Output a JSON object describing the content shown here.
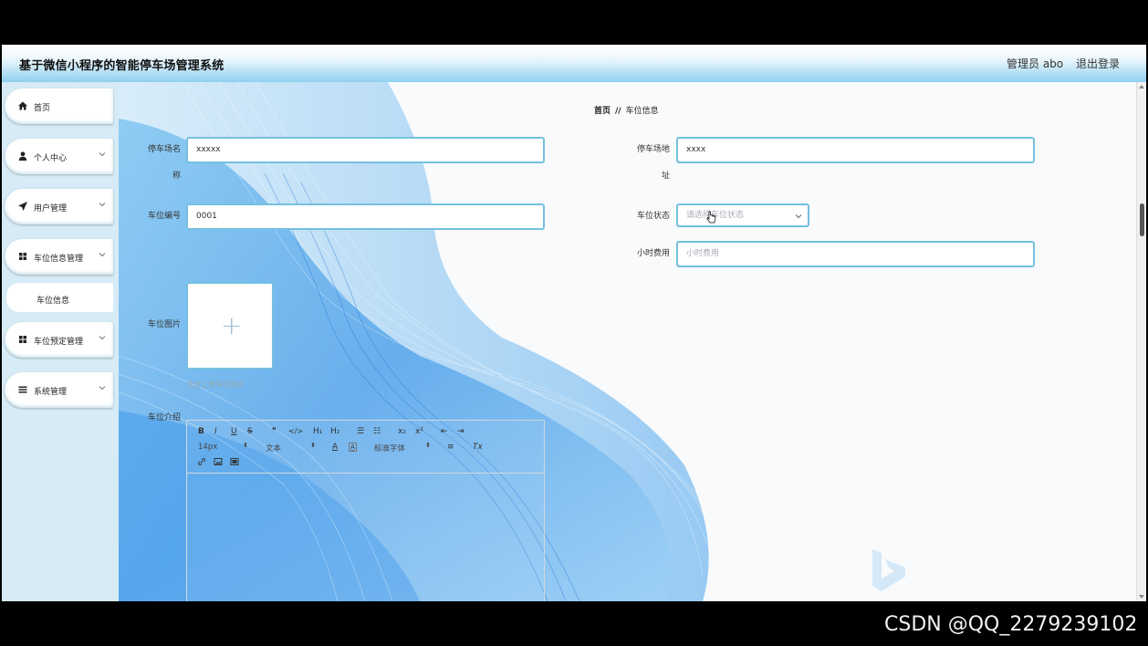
{
  "app": {
    "title": "基于微信小程序的智能停车场管理系统",
    "admin_label": "管理员 abo",
    "logout_label": "退出登录"
  },
  "sidebar": {
    "items": [
      {
        "label": "首页",
        "icon": "home-icon"
      },
      {
        "label": "个人中心",
        "icon": "user-icon"
      },
      {
        "label": "用户管理",
        "icon": "send-icon"
      },
      {
        "label": "车位信息管理",
        "icon": "grid-icon"
      },
      {
        "label": "车位信息",
        "icon": ""
      },
      {
        "label": "车位预定管理",
        "icon": "grid-icon"
      },
      {
        "label": "系统管理",
        "icon": "menu-icon"
      }
    ]
  },
  "breadcrumb": {
    "home": "首页",
    "separator": "//",
    "current": "车位信息"
  },
  "form": {
    "lot_name_label_line1": "停车场名",
    "lot_name_label_line2": "称",
    "lot_name_value": "xxxxx",
    "lot_address_label_line1": "停车场地",
    "lot_address_label_line2": "址",
    "lot_address_value": "xxxx",
    "space_no_label": "车位编号",
    "space_no_value": "0001",
    "status_label": "车位状态",
    "status_placeholder": "请选择车位状态",
    "hourly_fee_label": "小时费用",
    "hourly_fee_placeholder": "小时费用",
    "image_label": "车位图片",
    "image_hint": "点击上传车位图片",
    "intro_label": "车位介绍"
  },
  "editor": {
    "buttons": [
      "B",
      "I",
      "U",
      "S",
      "❞",
      "</>",
      "H₁",
      "H₂",
      "☰",
      "☷",
      "x₂",
      "x²",
      "⇤",
      "⇥",
      "A",
      "A̲",
      "≡",
      "Tx"
    ],
    "font_size": "14px",
    "text_type": "文本",
    "font_family": "标准字体"
  },
  "watermark": "CSDN @QQ_2279239102",
  "colors": {
    "accent": "#74c0e0",
    "topbar": "#8fd0ef",
    "sidebar": "#d6ebf5"
  }
}
